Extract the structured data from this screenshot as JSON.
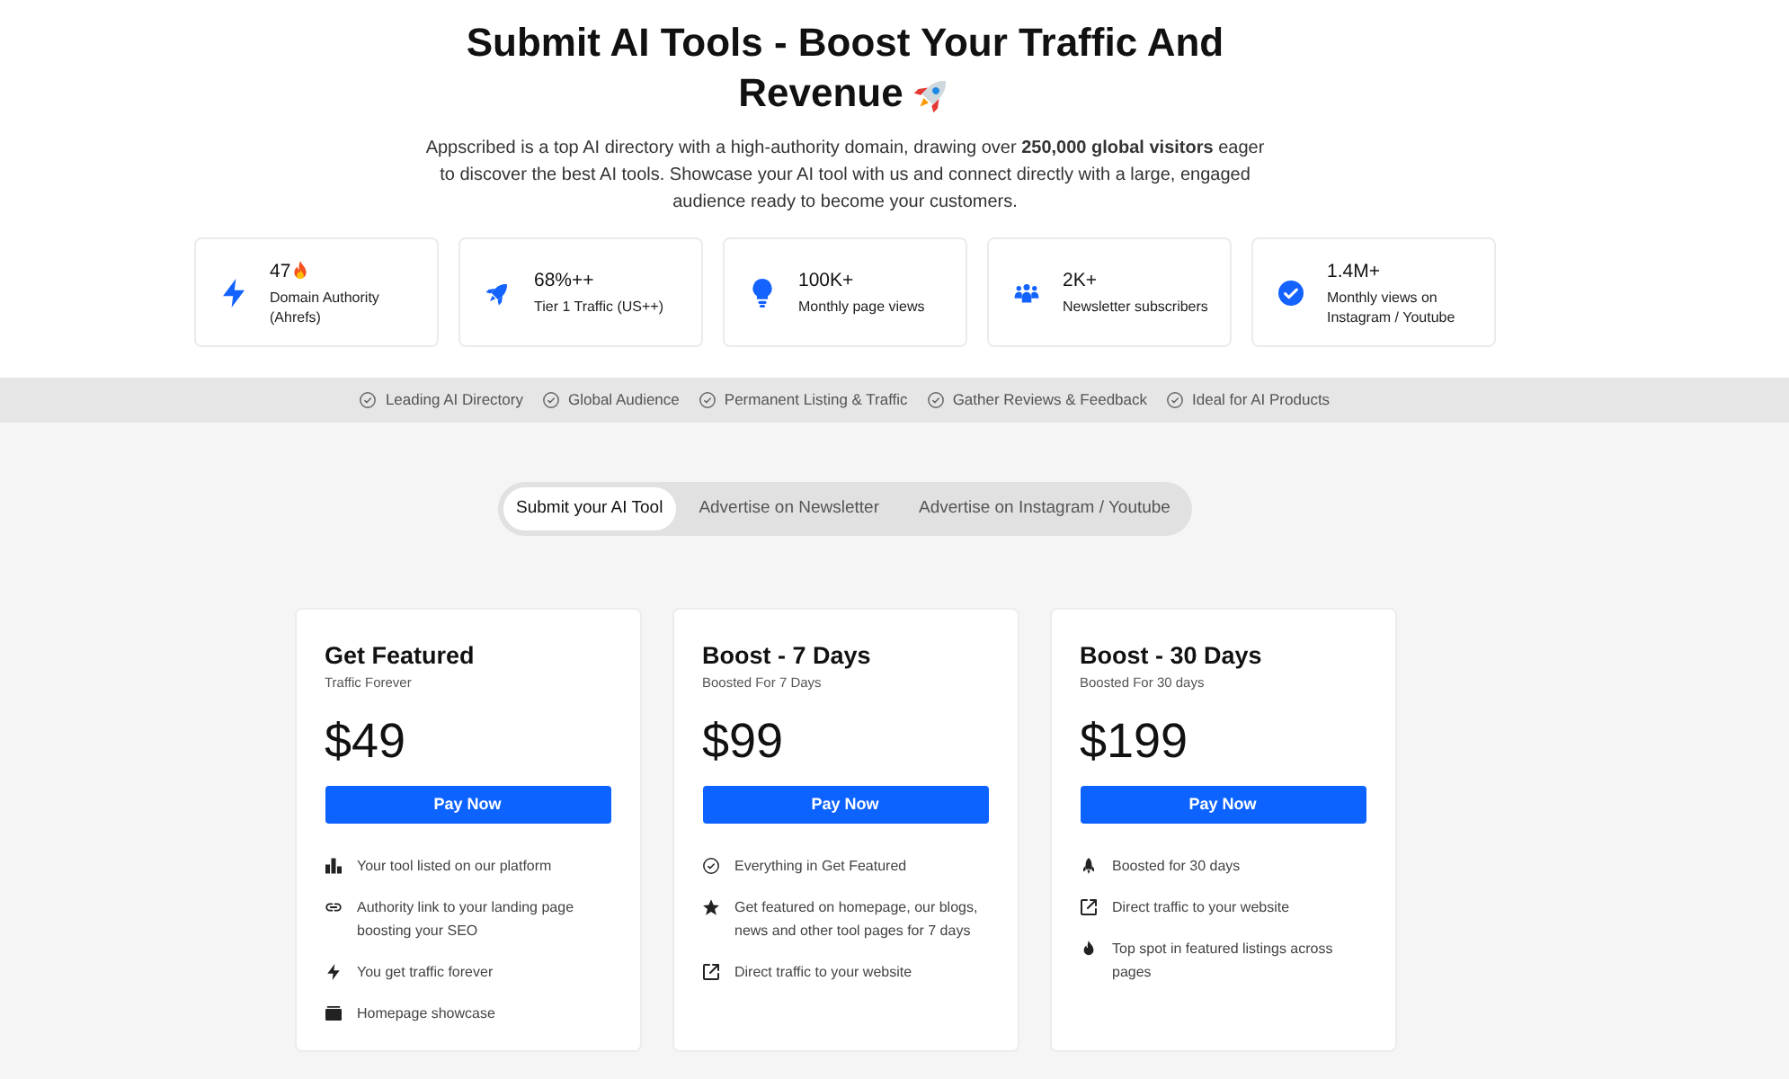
{
  "hero": {
    "title_lines": [
      "Submit AI Tools - Boost Your Traffic And",
      "Revenue"
    ],
    "description": "Appscribed is a top AI directory with a high-authority domain, drawing over **250,000 global visitors** eager to discover the best AI tools. Showcase your AI tool with us and connect directly with a large, engaged audience ready to become your customers."
  },
  "stats": [
    {
      "value": "47",
      "label": "Domain Authority (Ahrefs)"
    },
    {
      "value": "68%++",
      "label": "Tier 1 Traffic (US++)"
    },
    {
      "value": "100K+",
      "label": "Monthly page views"
    },
    {
      "value": "2K+",
      "label": "Newsletter subscribers"
    },
    {
      "value": "1.4M+",
      "label": "Monthly views on Instagram / Youtube"
    }
  ],
  "highlights": [
    "Leading AI Directory",
    "Global Audience",
    "Permanent Listing & Traffic",
    "Gather Reviews & Feedback",
    "Ideal for AI Products"
  ],
  "tabs": [
    {
      "label": "Submit your AI Tool",
      "selected": true
    },
    {
      "label": "Advertise on Newsletter",
      "selected": false
    },
    {
      "label": "Advertise on Instagram / Youtube",
      "selected": false
    }
  ],
  "plans": [
    {
      "name": "Get Featured",
      "subtitle": "Traffic Forever",
      "price": "$49",
      "button": "Pay Now",
      "features": [
        "Your tool listed on our platform",
        "Authority link to your landing page boosting your SEO",
        "You get traffic forever",
        "Homepage showcase"
      ]
    },
    {
      "name": "Boost - 7 Days",
      "subtitle": "Boosted For 7 Days",
      "price": "$99",
      "button": "Pay Now",
      "features": [
        "Everything in Get Featured",
        "Get featured on homepage, our blogs, news and other tool pages for 7 days",
        "Direct traffic to your website"
      ]
    },
    {
      "name": "Boost - 30 Days",
      "subtitle": "Boosted For 30 days",
      "price": "$199",
      "button": "Pay Now",
      "features": [
        "Boosted for 30 days",
        "Direct traffic to your website",
        "Top spot in featured listings across pages"
      ]
    }
  ]
}
